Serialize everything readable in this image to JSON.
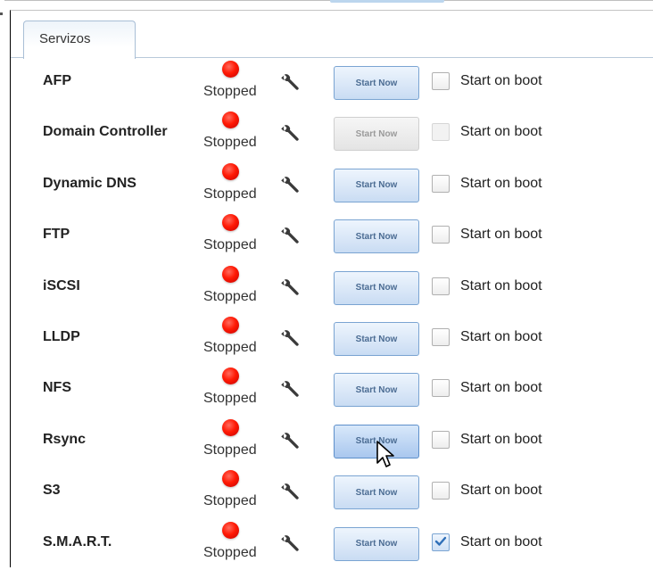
{
  "tabs": [
    {
      "label": "Servizos",
      "active": true
    }
  ],
  "colors": {
    "accent": "#7aa4d2",
    "led_stopped": "#ff1a05",
    "tab_border": "#a9bfd6"
  },
  "services": [
    {
      "name": "AFP",
      "status": "Stopped",
      "button": "Start Now",
      "button_enabled": true,
      "boot_label": "Start on boot",
      "start_on_boot": false,
      "boot_enabled": true
    },
    {
      "name": "Domain Controller",
      "status": "Stopped",
      "button": "Start Now",
      "button_enabled": false,
      "boot_label": "Start on boot",
      "start_on_boot": false,
      "boot_enabled": false
    },
    {
      "name": "Dynamic DNS",
      "status": "Stopped",
      "button": "Start Now",
      "button_enabled": true,
      "boot_label": "Start on boot",
      "start_on_boot": false,
      "boot_enabled": true
    },
    {
      "name": "FTP",
      "status": "Stopped",
      "button": "Start Now",
      "button_enabled": true,
      "boot_label": "Start on boot",
      "start_on_boot": false,
      "boot_enabled": true
    },
    {
      "name": "iSCSI",
      "status": "Stopped",
      "button": "Start Now",
      "button_enabled": true,
      "boot_label": "Start on boot",
      "start_on_boot": false,
      "boot_enabled": true
    },
    {
      "name": "LLDP",
      "status": "Stopped",
      "button": "Start Now",
      "button_enabled": true,
      "boot_label": "Start on boot",
      "start_on_boot": false,
      "boot_enabled": true
    },
    {
      "name": "NFS",
      "status": "Stopped",
      "button": "Start Now",
      "button_enabled": true,
      "boot_label": "Start on boot",
      "start_on_boot": false,
      "boot_enabled": true
    },
    {
      "name": "Rsync",
      "status": "Stopped",
      "button": "Start Now",
      "button_enabled": true,
      "button_hover": true,
      "boot_label": "Start on boot",
      "start_on_boot": false,
      "boot_enabled": true
    },
    {
      "name": "S3",
      "status": "Stopped",
      "button": "Start Now",
      "button_enabled": true,
      "boot_label": "Start on boot",
      "start_on_boot": false,
      "boot_enabled": true
    },
    {
      "name": "S.M.A.R.T.",
      "status": "Stopped",
      "button": "Start Now",
      "button_enabled": true,
      "boot_label": "Start on boot",
      "start_on_boot": true,
      "boot_enabled": true
    }
  ],
  "icons": {
    "status": "stopped-led-icon",
    "settings": "wrench-icon",
    "cursor": "mouse-pointer-icon"
  }
}
